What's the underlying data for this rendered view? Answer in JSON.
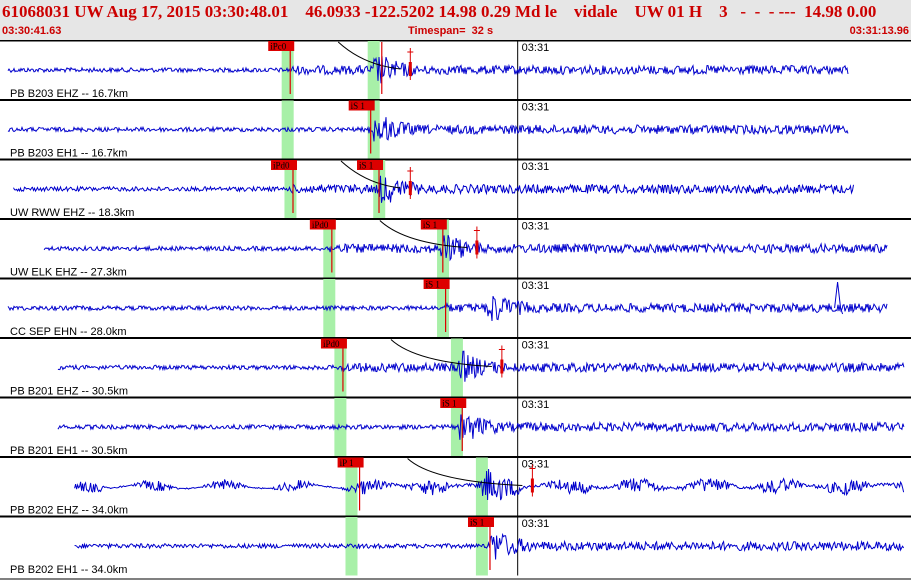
{
  "header": {
    "title": "61068031 UW Aug 17, 2015 03:30:48.01    46.0933 -122.5202 14.98 0.29 Md le    vidale    UW 01 H    3   -  -  - ---  14.98 0.00",
    "start_time": "03:30:41.63",
    "timespan": "Timespan=  32 s",
    "end_time": "03:31:13.96"
  },
  "colors": {
    "trace": "#0000cc",
    "pick": "#dd0000",
    "highlight": "#a8f0a8",
    "background": "#ffffff",
    "header_bg": "#e6e6e6"
  },
  "chart_data": {
    "type": "line",
    "title": "61068031 UW Aug 17, 2015 03:30:48.01    46.0933 -122.5202 14.98 0.29 Md le    vidale    UW 01 H    3   -  -  - ---  14.98 0.00",
    "x_units": "seconds after 03:30:41.63",
    "xlim": [
      0,
      32.33
    ],
    "minute_tick": {
      "label": "03:31",
      "x": 18.37
    },
    "series": [
      {
        "name": "PB B203 EHZ -- 16.7km",
        "start": 0,
        "end": 30.3,
        "onset": 10.1,
        "peak": 13.4,
        "picks": [
          {
            "label": "iPc0",
            "x": 10.1
          },
          {
            "label": "",
            "x": 13.4
          }
        ],
        "windows": [
          9.9,
          13.0
        ],
        "crosses": [
          14.5
        ]
      },
      {
        "name": "PB B203 EH1 -- 16.7km",
        "start": 0,
        "end": 30.3,
        "onset": 13.0,
        "peak": 13.4,
        "picks": [
          {
            "label": "iS 1",
            "x": 13.0
          }
        ],
        "windows": [
          9.9,
          13.0
        ],
        "crosses": []
      },
      {
        "name": "UW RWW EHZ -- 18.3km",
        "start": 0.2,
        "end": 30.5,
        "onset": 10.2,
        "peak": 13.6,
        "picks": [
          {
            "label": "iPd0",
            "x": 10.2
          },
          {
            "label": "iS 1",
            "x": 13.3
          }
        ],
        "windows": [
          10.0,
          13.2
        ],
        "crosses": [
          14.5
        ]
      },
      {
        "name": "UW ELK EHZ -- 27.3km",
        "start": 1.3,
        "end": 31.7,
        "onset": 11.6,
        "peak": 15.8,
        "picks": [
          {
            "label": "iPd0",
            "x": 11.6
          },
          {
            "label": "iS 1",
            "x": 15.6
          }
        ],
        "windows": [
          11.4,
          15.5
        ],
        "crosses": [
          16.9
        ]
      },
      {
        "name": "CC SEP EHN -- 28.0km",
        "start": 0,
        "end": 31.7,
        "onset": 15.7,
        "peak": 17.5,
        "picks": [
          {
            "label": "iS 1",
            "x": 15.7
          }
        ],
        "windows": [
          11.4,
          15.5
        ],
        "crosses": []
      },
      {
        "name": "PB B201 EHZ -- 30.5km",
        "start": 1.8,
        "end": 32.3,
        "onset": 12.0,
        "peak": 16.4,
        "picks": [
          {
            "label": "iPd0",
            "x": 12.0
          }
        ],
        "windows": [
          11.8,
          16.0
        ],
        "crosses": [
          17.8
        ]
      },
      {
        "name": "PB B201 EH1 -- 30.5km",
        "start": 1.8,
        "end": 32.3,
        "onset": 16.3,
        "peak": 16.5,
        "picks": [
          {
            "label": "iS 1",
            "x": 16.3
          }
        ],
        "windows": [
          11.8,
          16.0
        ],
        "crosses": []
      },
      {
        "name": "PB B202 EHZ -- 34.0km",
        "start": 2.4,
        "end": 32.3,
        "onset": 12.6,
        "peak": 17.3,
        "picks": [
          {
            "label": "iP 1",
            "x": 12.6
          }
        ],
        "windows": [
          12.2,
          16.9
        ],
        "crosses": [
          18.9
        ]
      },
      {
        "name": "PB B202 EH1 -- 34.0km",
        "start": 2.4,
        "end": 32.3,
        "onset": 17.3,
        "peak": 17.6,
        "picks": [
          {
            "label": "iS 1",
            "x": 17.3
          }
        ],
        "windows": [
          12.2,
          16.9
        ],
        "crosses": []
      }
    ]
  }
}
